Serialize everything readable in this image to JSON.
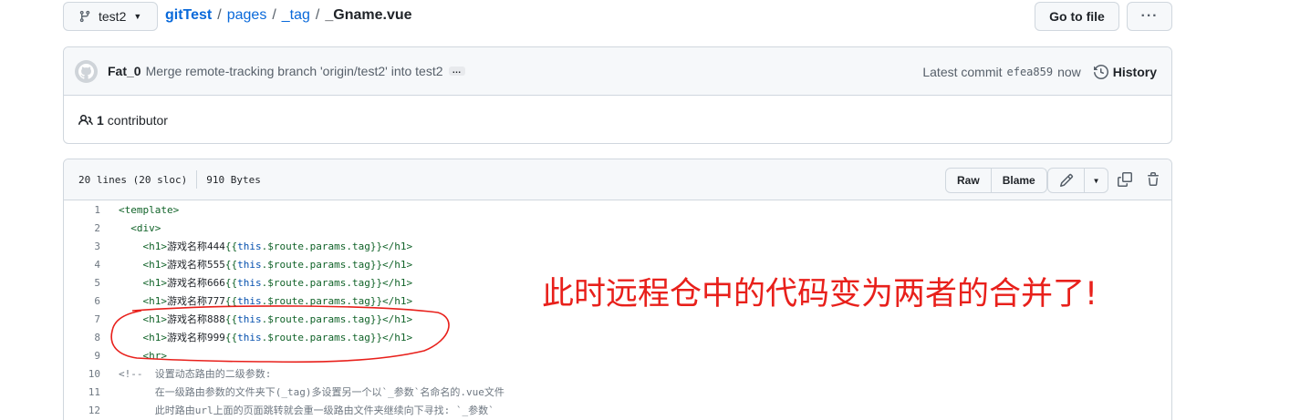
{
  "topbar": {
    "branch": "test2",
    "crumbs": {
      "repo": "gitTest",
      "dir1": "pages",
      "dir2": "_tag",
      "sep": "/",
      "file": "_Gname.vue"
    },
    "goto_file": "Go to file",
    "more": "···"
  },
  "commit": {
    "author": "Fat_0",
    "message": "Merge remote-tracking branch 'origin/test2' into test2",
    "ellipsis": "…",
    "latest_label": "Latest commit",
    "sha": "efea859",
    "time": "now",
    "history": "History"
  },
  "contributors": {
    "count": "1",
    "label": "contributor"
  },
  "file": {
    "lines_info": "20 lines (20 sloc)",
    "size": "910 Bytes",
    "raw": "Raw",
    "blame": "Blame"
  },
  "code_lines": [
    {
      "n": "1",
      "parts": [
        [
          "t",
          "<template>"
        ]
      ]
    },
    {
      "n": "2",
      "parts": [
        [
          "t",
          "  <div>"
        ]
      ]
    },
    {
      "n": "3",
      "parts": [
        [
          "t",
          "    <h1>"
        ],
        [
          "c",
          "游戏名称444"
        ],
        [
          "t",
          "{{"
        ],
        [
          "k",
          "this"
        ],
        [
          "t",
          ".$route.params.tag}}</h1>"
        ]
      ]
    },
    {
      "n": "4",
      "parts": [
        [
          "t",
          "    <h1>"
        ],
        [
          "c",
          "游戏名称555"
        ],
        [
          "t",
          "{{"
        ],
        [
          "k",
          "this"
        ],
        [
          "t",
          ".$route.params.tag}}</h1>"
        ]
      ]
    },
    {
      "n": "5",
      "parts": [
        [
          "t",
          "    <h1>"
        ],
        [
          "c",
          "游戏名称666"
        ],
        [
          "t",
          "{{"
        ],
        [
          "k",
          "this"
        ],
        [
          "t",
          ".$route.params.tag}}</h1>"
        ]
      ]
    },
    {
      "n": "6",
      "parts": [
        [
          "t",
          "    <h1>"
        ],
        [
          "c",
          "游戏名称777"
        ],
        [
          "t",
          "{{"
        ],
        [
          "k",
          "this"
        ],
        [
          "t",
          ".$route.params.tag}}</h1>"
        ]
      ]
    },
    {
      "n": "7",
      "parts": [
        [
          "t",
          "    <h1>"
        ],
        [
          "c",
          "游戏名称888"
        ],
        [
          "t",
          "{{"
        ],
        [
          "k",
          "this"
        ],
        [
          "t",
          ".$route.params.tag}}</h1>"
        ]
      ]
    },
    {
      "n": "8",
      "parts": [
        [
          "t",
          "    <h1>"
        ],
        [
          "c",
          "游戏名称999"
        ],
        [
          "t",
          "{{"
        ],
        [
          "k",
          "this"
        ],
        [
          "t",
          ".$route.params.tag}}</h1>"
        ]
      ]
    },
    {
      "n": "9",
      "parts": [
        [
          "t",
          "    <hr>"
        ]
      ]
    },
    {
      "n": "10",
      "parts": [
        [
          "m",
          "<!--  设置动态路由的二级参数:"
        ]
      ]
    },
    {
      "n": "11",
      "parts": [
        [
          "m",
          "      在一级路由参数的文件夹下(_tag)多设置另一个以`_参数`名命名的.vue文件"
        ]
      ]
    },
    {
      "n": "12",
      "parts": [
        [
          "m",
          "      此时路由url上面的页面跳转就会重一级路由文件夹继续向下寻找: `_参数`"
        ]
      ]
    }
  ],
  "annotation": {
    "text": "此时远程仓中的代码变为两者的合并了!",
    "color": "#e8201b"
  }
}
